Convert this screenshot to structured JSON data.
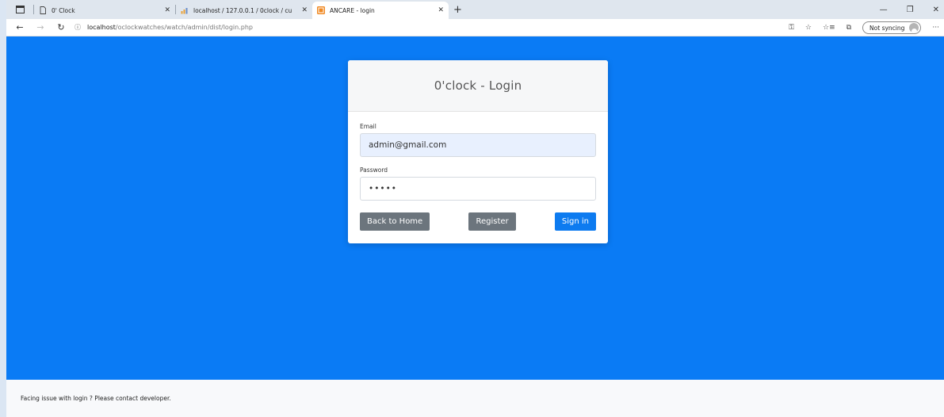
{
  "browser": {
    "tabs": [
      {
        "label": "0' Clock",
        "active": false
      },
      {
        "label": "localhost / 127.0.0.1 / 0clock / cu",
        "active": false
      },
      {
        "label": "ANCARE - login",
        "active": true
      }
    ],
    "address": {
      "host": "localhost",
      "path": "/oclockwatches/watch/admin/dist/login.php"
    },
    "sync_label": "Not syncing"
  },
  "login": {
    "title": "0'clock - Login",
    "email_label": "Email",
    "email_value": "admin@gmail.com",
    "password_label": "Password",
    "password_value": "•••••",
    "back_home_label": "Back to Home",
    "register_label": "Register",
    "signin_label": "Sign in"
  },
  "footer": {
    "text": "Facing issue with login ? Please contact developer."
  },
  "colors": {
    "page_background": "#0a7bf5",
    "primary_button": "#0d7bf0",
    "secondary_button": "#6c757d"
  }
}
